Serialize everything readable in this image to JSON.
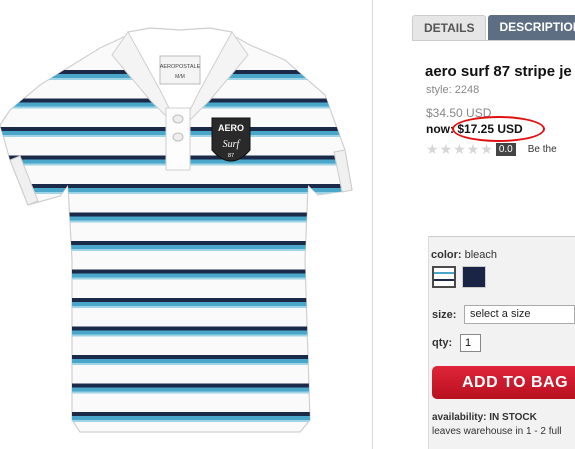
{
  "tabs": {
    "details": "DETAILS",
    "description": "DESCRIPTION"
  },
  "product": {
    "title": "aero surf 87 stripe je",
    "style": "style: 2248",
    "price_was": "$34.50 USD",
    "price_now_label": "now",
    "price_now_value": ": $17.25 USD",
    "rating_value": "0.0",
    "rating_text": "Be the",
    "stars": 5,
    "rating_stars_filled": 0
  },
  "shirt_logo": {
    "brand_tag": "AEROPOSTALE",
    "size_tag": "M/M",
    "patch_top": "AERO",
    "patch_script": "Surf",
    "patch_num": "87"
  },
  "options": {
    "color_label": "color:",
    "color_value": "bleach",
    "size_label": "size:",
    "size_placeholder": "select a size",
    "qty_label": "qty:",
    "qty_value": "1",
    "add_to_bag": "ADD TO BAG",
    "availability_label": "availability:",
    "availability_value": "IN STOCK",
    "leaves_text": "leaves warehouse in 1 - 2 full"
  },
  "colors": {
    "accent_red": "#e01010",
    "tab_blue": "#5d6e83",
    "button_red": "#c81a2b",
    "stripe_navy": "#1c2a4a",
    "stripe_blue": "#4aa7c9"
  }
}
